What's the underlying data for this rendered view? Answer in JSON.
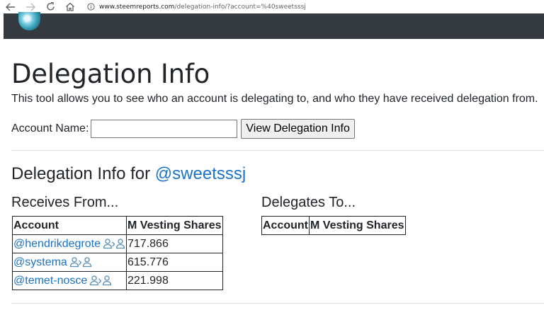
{
  "browser": {
    "url_host": "www.steemreports.com",
    "url_path": "/delegation-info/?account=%40sweetsssj"
  },
  "page": {
    "title": "Delegation Info",
    "description": "This tool allows you to see who an account is delegating to, and who they have received delegation from.",
    "account_label": "Account Name:",
    "account_value": "",
    "view_button": "View Delegation Info",
    "section_prefix": "Delegation Info for ",
    "section_account": "@sweetsssj"
  },
  "receives_from": {
    "heading": "Receives From...",
    "columns": [
      "Account",
      "M Vesting Shares"
    ],
    "rows": [
      {
        "account": "@hendrikdegrote",
        "shares": "717.866"
      },
      {
        "account": "@systema",
        "shares": "615.776"
      },
      {
        "account": "@temet-nosce",
        "shares": "221.998"
      }
    ]
  },
  "delegates_to": {
    "heading": "Delegates To...",
    "columns": [
      "Account",
      "M Vesting Shares"
    ],
    "rows": []
  },
  "icons": {
    "delegation": "delegation-history-icon"
  }
}
